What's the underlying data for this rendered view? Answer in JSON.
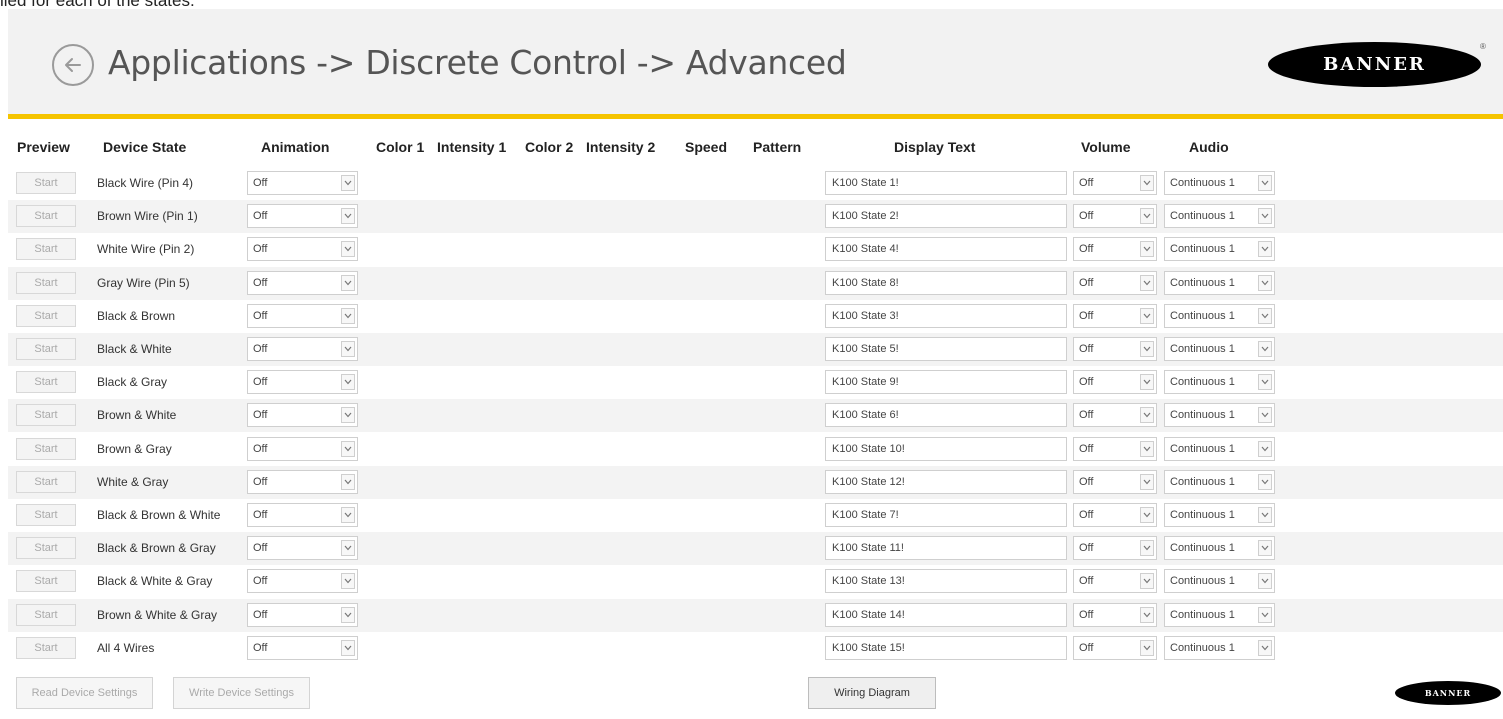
{
  "caption": "lied for each of the states.",
  "header": {
    "title": "Applications -> Discrete Control -> Advanced",
    "logo_text": "BANNER",
    "accent_color": "#f5c400"
  },
  "columns": {
    "preview": "Preview",
    "device_state": "Device State",
    "animation": "Animation",
    "color1": "Color 1",
    "intensity1": "Intensity 1",
    "color2": "Color 2",
    "intensity2": "Intensity 2",
    "speed": "Speed",
    "pattern": "Pattern",
    "display_text": "Display Text",
    "volume": "Volume",
    "audio": "Audio"
  },
  "rows": [
    {
      "start": "Start",
      "state": "Black Wire (Pin 4)",
      "animation": "Off",
      "display_text": "K100 State 1!",
      "volume": "Off",
      "audio": "Continuous 1"
    },
    {
      "start": "Start",
      "state": "Brown Wire (Pin 1)",
      "animation": "Off",
      "display_text": "K100 State 2!",
      "volume": "Off",
      "audio": "Continuous 1"
    },
    {
      "start": "Start",
      "state": "White Wire (Pin 2)",
      "animation": "Off",
      "display_text": "K100 State 4!",
      "volume": "Off",
      "audio": "Continuous 1"
    },
    {
      "start": "Start",
      "state": "Gray Wire (Pin 5)",
      "animation": "Off",
      "display_text": "K100 State 8!",
      "volume": "Off",
      "audio": "Continuous 1"
    },
    {
      "start": "Start",
      "state": "Black & Brown",
      "animation": "Off",
      "display_text": "K100 State 3!",
      "volume": "Off",
      "audio": "Continuous 1"
    },
    {
      "start": "Start",
      "state": "Black & White",
      "animation": "Off",
      "display_text": "K100 State 5!",
      "volume": "Off",
      "audio": "Continuous 1"
    },
    {
      "start": "Start",
      "state": "Black & Gray",
      "animation": "Off",
      "display_text": "K100 State 9!",
      "volume": "Off",
      "audio": "Continuous 1"
    },
    {
      "start": "Start",
      "state": "Brown & White",
      "animation": "Off",
      "display_text": "K100 State 6!",
      "volume": "Off",
      "audio": "Continuous 1"
    },
    {
      "start": "Start",
      "state": "Brown & Gray",
      "animation": "Off",
      "display_text": "K100 State 10!",
      "volume": "Off",
      "audio": "Continuous 1"
    },
    {
      "start": "Start",
      "state": "White & Gray",
      "animation": "Off",
      "display_text": "K100 State 12!",
      "volume": "Off",
      "audio": "Continuous 1"
    },
    {
      "start": "Start",
      "state": "Black & Brown & White",
      "animation": "Off",
      "display_text": "K100 State 7!",
      "volume": "Off",
      "audio": "Continuous 1"
    },
    {
      "start": "Start",
      "state": "Black & Brown & Gray",
      "animation": "Off",
      "display_text": "K100 State 11!",
      "volume": "Off",
      "audio": "Continuous 1"
    },
    {
      "start": "Start",
      "state": "Black & White & Gray",
      "animation": "Off",
      "display_text": "K100 State 13!",
      "volume": "Off",
      "audio": "Continuous 1"
    },
    {
      "start": "Start",
      "state": "Brown & White & Gray",
      "animation": "Off",
      "display_text": "K100 State 14!",
      "volume": "Off",
      "audio": "Continuous 1"
    },
    {
      "start": "Start",
      "state": "All 4 Wires",
      "animation": "Off",
      "display_text": "K100 State 15!",
      "volume": "Off",
      "audio": "Continuous 1"
    }
  ],
  "footer": {
    "read_label": "Read Device Settings",
    "write_label": "Write Device Settings",
    "wiring_label": "Wiring Diagram",
    "logo_text": "BANNER"
  }
}
